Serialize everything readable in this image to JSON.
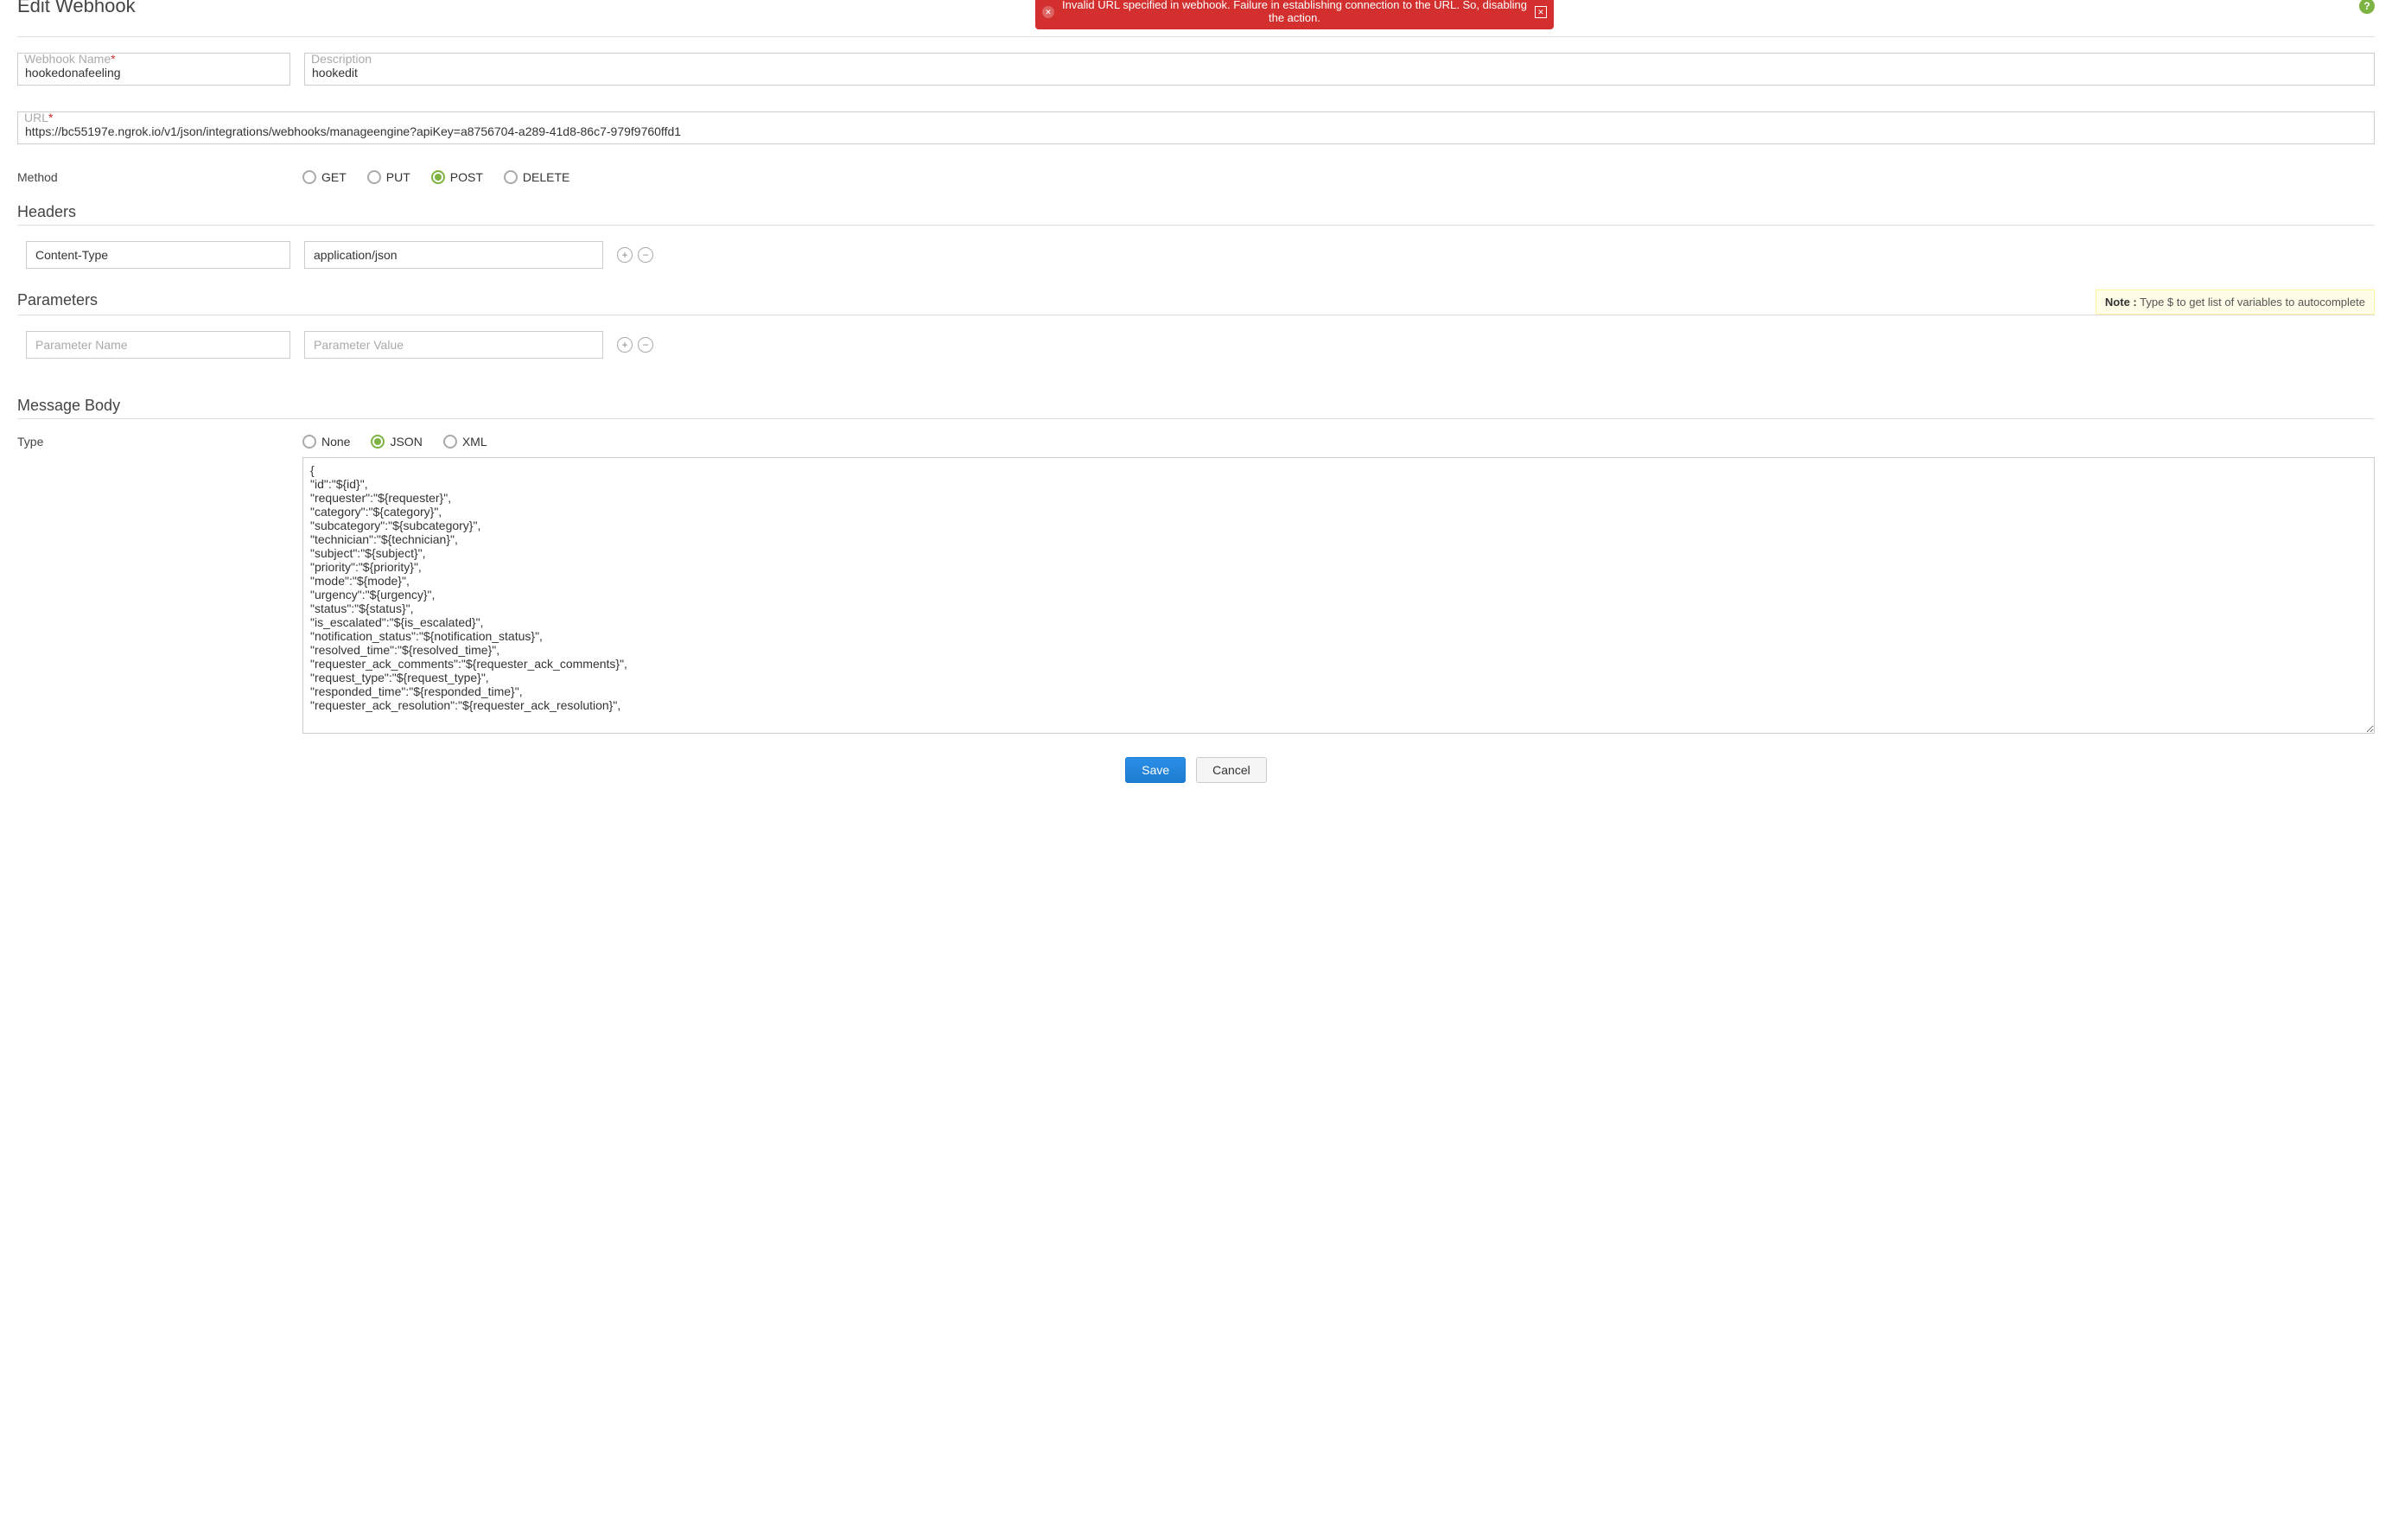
{
  "page_title": "Edit Webhook",
  "error_banner": "Invalid URL specified in webhook. Failure in establishing connection to the URL. So, disabling the action.",
  "fields": {
    "name_label": "Webhook Name",
    "name_required": "*",
    "name_value": "hookedonafeeling",
    "desc_label": "Description",
    "desc_value": "hookedit",
    "url_label": "URL",
    "url_required": "*",
    "url_value": "https://bc55197e.ngrok.io/v1/json/integrations/webhooks/manageengine?apiKey=a8756704-a289-41d8-86c7-979f9760ffd1"
  },
  "method": {
    "label": "Method",
    "options": [
      "GET",
      "PUT",
      "POST",
      "DELETE"
    ],
    "selected": "POST"
  },
  "headers": {
    "title": "Headers",
    "rows": [
      {
        "name": "Content-Type",
        "value": "application/json"
      }
    ]
  },
  "parameters": {
    "title": "Parameters",
    "note_label": "Note :",
    "note_text": " Type $ to get list of variables to autocomplete",
    "name_placeholder": "Parameter Name",
    "value_placeholder": "Parameter Value",
    "rows": [
      {
        "name": "",
        "value": ""
      }
    ]
  },
  "body": {
    "title": "Message Body",
    "type_label": "Type",
    "type_options": [
      "None",
      "JSON",
      "XML"
    ],
    "type_selected": "JSON",
    "content": "{\n\"id\":\"${id}\",\n\"requester\":\"${requester}\",\n\"category\":\"${category}\",\n\"subcategory\":\"${subcategory}\",\n\"technician\":\"${technician}\",\n\"subject\":\"${subject}\",\n\"priority\":\"${priority}\",\n\"mode\":\"${mode}\",\n\"urgency\":\"${urgency}\",\n\"status\":\"${status}\",\n\"is_escalated\":\"${is_escalated}\",\n\"notification_status\":\"${notification_status}\",\n\"resolved_time\":\"${resolved_time}\",\n\"requester_ack_comments\":\"${requester_ack_comments}\",\n\"request_type\":\"${request_type}\",\n\"responded_time\":\"${responded_time}\",\n\"requester_ack_resolution\":\"${requester_ack_resolution}\","
  },
  "buttons": {
    "save": "Save",
    "cancel": "Cancel"
  }
}
